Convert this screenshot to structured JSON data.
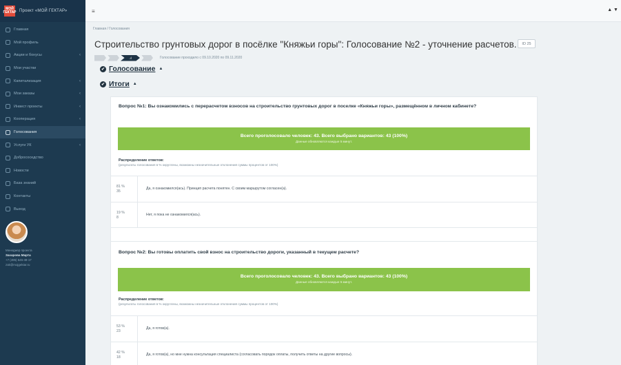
{
  "brand": {
    "logo_text": "МОЙ ГЕКТАР",
    "title": "Проект «МОЙ ГЕКТАР»"
  },
  "sidebar": {
    "items": [
      {
        "label": "Главная",
        "has_arrow": false,
        "icon": "grid-icon"
      },
      {
        "label": "Мой профиль",
        "has_arrow": false,
        "icon": "user-icon"
      },
      {
        "label": "Акции и бонусы",
        "has_arrow": true,
        "icon": "gift-icon"
      },
      {
        "label": "Мои участки",
        "has_arrow": false,
        "icon": "map-icon"
      },
      {
        "label": "Капитализация",
        "has_arrow": true,
        "icon": "chart-icon"
      },
      {
        "label": "Мои заказы",
        "has_arrow": true,
        "icon": "cart-icon"
      },
      {
        "label": "Инвест проекты",
        "has_arrow": true,
        "icon": "briefcase-icon"
      },
      {
        "label": "Кооперация",
        "has_arrow": true,
        "icon": "handshake-icon"
      },
      {
        "label": "Голосования",
        "has_arrow": false,
        "icon": "ballot-icon",
        "active": true
      },
      {
        "label": "Услуги УК",
        "has_arrow": true,
        "icon": "tools-icon"
      },
      {
        "label": "Добрососедство",
        "has_arrow": false,
        "icon": "heart-icon"
      },
      {
        "label": "Новости",
        "has_arrow": false,
        "icon": "news-icon"
      },
      {
        "label": "База знаний",
        "has_arrow": false,
        "icon": "book-icon"
      },
      {
        "label": "Контакты",
        "has_arrow": false,
        "icon": "phone-icon"
      },
      {
        "label": "Выход",
        "has_arrow": false,
        "icon": "logout-icon"
      }
    ],
    "manager": {
      "role": "Менеджер проекта",
      "name": "Захарова Марта",
      "phone": "+7 (495) 545-49-17",
      "email": "zak@mojgektar.ru"
    }
  },
  "topbar": {
    "menu_glyph": "≡",
    "right_glyphs": "▲ ▼"
  },
  "breadcrumb": "Главная / Голосования",
  "page_title": "Строительство грунтовых дорог в посёлке \"Княжьи горы\": Голосование №2 - уточнение расчетов.",
  "id_badge": "ID 25",
  "voting_period": "Голосование проходило с 09.10.2020 по 09.11.2020",
  "step_current_label": ".ıl",
  "sections": {
    "voting": "Голосование",
    "results": "Итоги"
  },
  "questions": [
    {
      "title": "Вопрос №1: Вы ознакомились с перерасчетом взносов на строительство грунтовых дорог в поселке «Княжьи горы», размещённом в личном кабинете?",
      "banner_main": "Всего проголосовало человек: 43. Всего выбрано вариантов: 43 (100%)",
      "banner_sub": "Данные обновляются каждые 5 минут.",
      "dist_label": "Распределение ответов:",
      "dist_note": "(результаты голосования в % округлены, возможны незначительные отклонения суммы процентов от 100%)",
      "answers": [
        {
          "percent": "81 %",
          "count": "35",
          "text": "Да, я ознакомился(ась). Принцип расчета понятен. С своим маршрутом согласен(а)."
        },
        {
          "percent": "19 %",
          "count": "8",
          "text": "Нет, я пока не ознакомился(ась)."
        }
      ]
    },
    {
      "title": "Вопрос №2: Вы готовы оплатить свой взнос на строительство дороги, указанный в текущем расчете?",
      "banner_main": "Всего проголосовало человек: 43. Всего выбрано вариантов: 43 (100%)",
      "banner_sub": "Данные обновляются каждые 5 минут.",
      "dist_label": "Распределение ответов:",
      "dist_note": "(результаты голосования в % округлены, возможны незначительные отклонения суммы процентов от 100%)",
      "answers": [
        {
          "percent": "53 %",
          "count": "23",
          "text": "Да, я готов(а)."
        },
        {
          "percent": "42 %",
          "count": "18",
          "text": "Да, я готов(а), но мне нужна консультация специалиста (согласовать порядок оплаты, получить ответы на другие вопросы)."
        }
      ]
    }
  ],
  "colors": {
    "sidebar_bg": "#1d3a50",
    "banner_green": "#8bc34a",
    "logo_red": "#e14b3a"
  }
}
